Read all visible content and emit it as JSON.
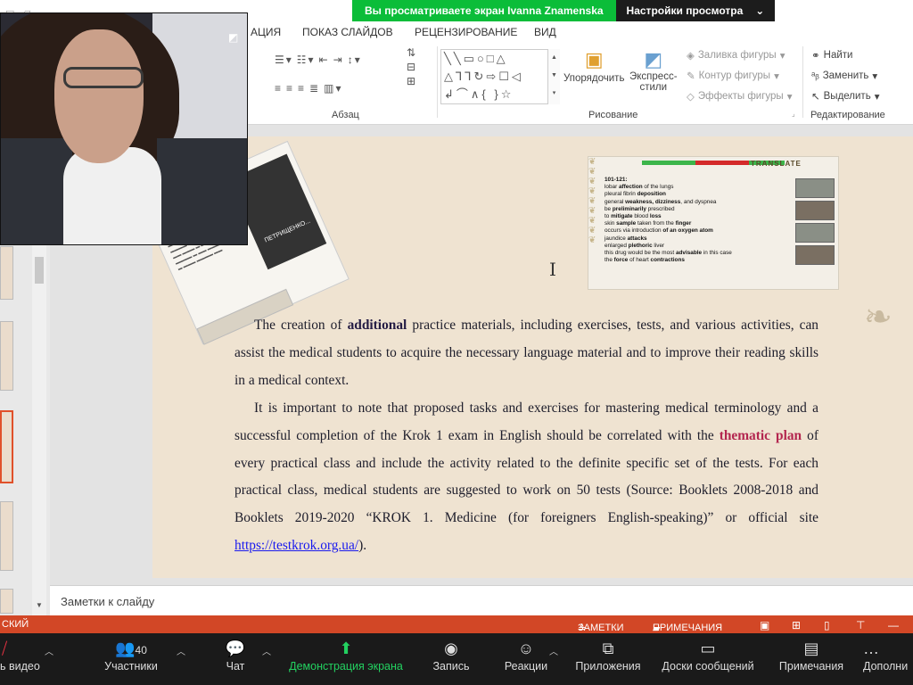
{
  "zoom_banner": {
    "message": "Вы просматриваете экран Ivanna Znamenska",
    "settings": "Настройки просмотра",
    "settings_caret": "⌄"
  },
  "ribbon": {
    "tabs": [
      "АЦИЯ",
      "ПОКАЗ СЛАЙДОВ",
      "РЕЦЕНЗИРОВАНИЕ",
      "ВИД"
    ],
    "groups": {
      "paragraph": "Абзац",
      "drawing": "Рисование",
      "editing": "Редактирование"
    },
    "arrange": "Упорядочить",
    "quick_styles_line1": "Экспресс-",
    "quick_styles_line2": "стили",
    "fill": "Заливка фигуры",
    "outline": "Контур фигуры",
    "effects": "Эффекты фигуры",
    "find": "Найти",
    "replace": "Заменить",
    "select": "Выделить"
  },
  "slide": {
    "para1_pre": "The creation of ",
    "para1_em": "additional",
    "para1_post": " practice materials, including exercises, tests, and various activities, can assist the medical students to acquire the necessary language material and to improve their reading skills in a medical context.",
    "para2_pre": "It is important to note that proposed tasks and exercises for mastering medical terminology and a successful completion of the Krok 1 exam in English should be correlated with the ",
    "para2_em": "thematic plan",
    "para2_post": " of every practical class and include the activity related to the definite specific set of the tests. For each practical class, medical students are suggested to work on 50 tests (Source: Booklets 2008-2018 and Booklets 2019-2020 “KROK 1. Medicine (for foreigners English-speaking)” or official site ",
    "link": "https://testkrok.org.ua/",
    "para2_end": ").",
    "screenshot_title": "TRANSLATE",
    "screenshot_lines": [
      [
        "101-121:",
        ""
      ],
      [
        "lobar ",
        "affection",
        " of the lungs"
      ],
      [
        "pleural fibrin ",
        "deposition",
        ""
      ],
      [
        "general ",
        "weakness, dizziness",
        ", and dyspnea"
      ],
      [
        "be ",
        "preliminarily",
        " prescribed"
      ],
      [
        "to ",
        "mitigate",
        " blood ",
        "loss"
      ],
      [
        "skin ",
        "sample",
        " taken from the ",
        "finger"
      ],
      [
        "occurs via introduction",
        " of an oxygen atom"
      ],
      [
        "jaundice",
        " attacks"
      ],
      [
        "enlarged ",
        "plethoric",
        " liver"
      ],
      [
        "this drug would be the most ",
        "advisable",
        " in this case"
      ],
      [
        "the ",
        "force",
        " of heart ",
        "contractions"
      ]
    ],
    "collage_label": "ПЕТРИЩЕНКО..."
  },
  "notes_placeholder": "Заметки к слайду",
  "status_bar": {
    "language": "СКИЙ",
    "notes": "ЗАМЕТКИ",
    "comments": "ПРИМЕЧАНИЯ"
  },
  "zoom_toolbar": {
    "video": "ь видео",
    "participants": "Участники",
    "participants_count": "40",
    "chat": "Чат",
    "share": "Демонстрация экрана",
    "record": "Запись",
    "reactions": "Реакции",
    "apps": "Приложения",
    "whiteboards": "Доски сообщений",
    "notes": "Примечания",
    "more": "Дополни"
  }
}
